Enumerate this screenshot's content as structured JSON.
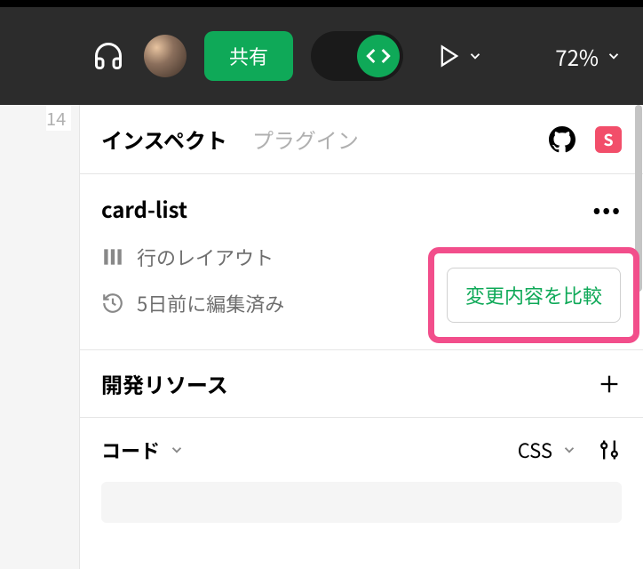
{
  "topbar": {
    "share_label": "共有",
    "zoom_value": "72%"
  },
  "canvas": {
    "frame_number": "14"
  },
  "tabs": {
    "inspect": "インスペクト",
    "plugins": "プラグイン"
  },
  "selection": {
    "name": "card-list",
    "layout_label": "行のレイアウト",
    "edited_label": "5日前に編集済み",
    "compare_label": "変更内容を比較"
  },
  "dev_resources": {
    "title": "開発リソース"
  },
  "code": {
    "title": "コード",
    "lang": "CSS"
  },
  "s_badge": "S"
}
